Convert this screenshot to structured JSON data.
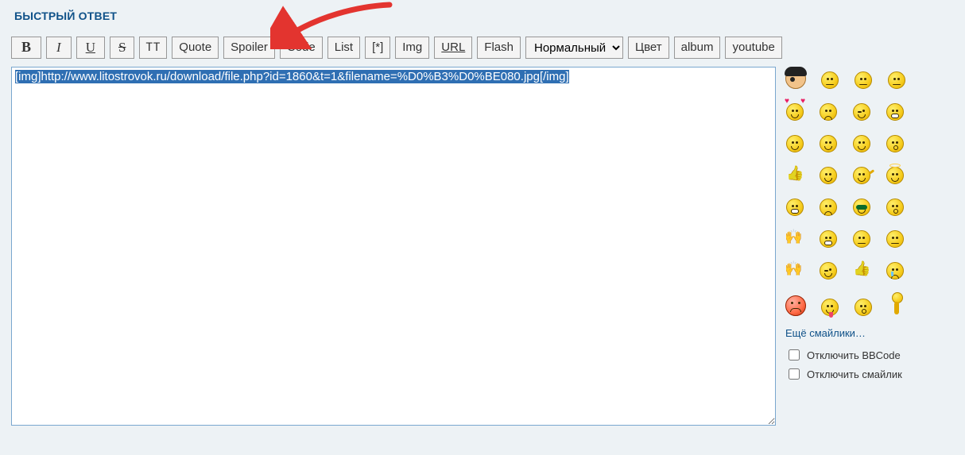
{
  "header": {
    "title": "БЫСТРЫЙ ОТВЕТ"
  },
  "toolbar": {
    "bold": "B",
    "italic": "I",
    "underline": "U",
    "strike": "S",
    "tt": "TT",
    "quote": "Quote",
    "spoiler": "Spoiler",
    "code": "Code",
    "list": "List",
    "list_item": "[*]",
    "img": "Img",
    "url": "URL",
    "flash": "Flash",
    "font_size_selected": "Нормальный",
    "color": "Цвет",
    "album": "album",
    "youtube": "youtube"
  },
  "editor": {
    "value": "[img]http://www.litostrovok.ru/download/file.php?id=1860&t=1&filename=%D0%B3%D0%BE080.jpg[/img]"
  },
  "smileys": {
    "more_link": "Ещё смайлики…",
    "set": [
      "pirate",
      "tired",
      "meh",
      "sleepy",
      "hearts",
      "confused",
      "wink",
      "teeth",
      "shy",
      "happy",
      "smirk",
      "surprised",
      "thumbs-up",
      "glance",
      "wave",
      "halo",
      "laugh",
      "frown",
      "cool",
      "whistle",
      "hands",
      "grin-wide",
      "wary",
      "unsure",
      "clap",
      "wink2",
      "thumb2",
      "cry",
      "red-angry",
      "tongue",
      "yell",
      "dance"
    ]
  },
  "options": {
    "disable_bbcode": "Отключить BBCode",
    "disable_smileys": "Отключить смайлик"
  }
}
